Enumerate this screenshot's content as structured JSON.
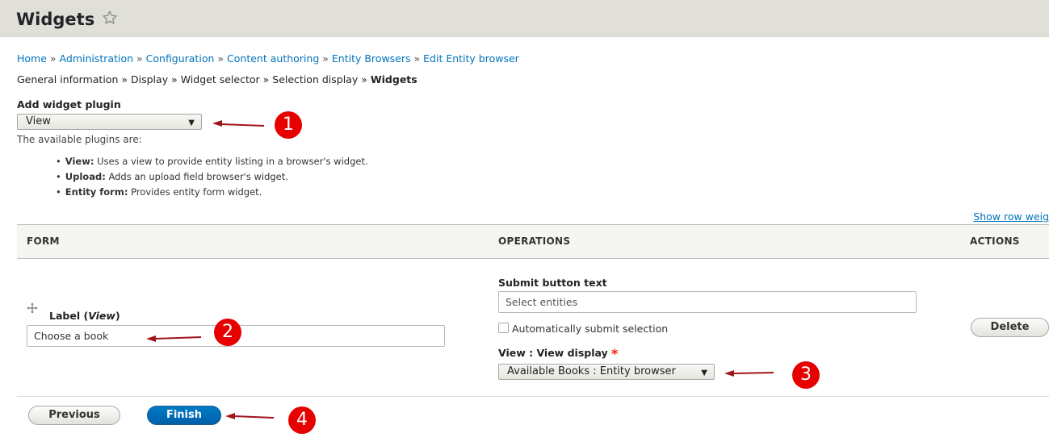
{
  "header": {
    "title": "Widgets",
    "star_icon": "star-outline-icon"
  },
  "breadcrumb": {
    "items": [
      "Home",
      "Administration",
      "Configuration",
      "Content authoring",
      "Entity Browsers",
      "Edit Entity browser"
    ],
    "separator": "»"
  },
  "wizard_steps": {
    "items": [
      "General information",
      "Display",
      "Widget selector",
      "Selection display"
    ],
    "current": "Widgets",
    "separator": "»"
  },
  "add_widget": {
    "label": "Add widget plugin",
    "selected": "View",
    "help_intro": "The available plugins are:",
    "plugins": [
      {
        "name": "View:",
        "desc": "Uses a view to provide entity listing in a browser's widget."
      },
      {
        "name": "Upload:",
        "desc": "Adds an upload field browser's widget."
      },
      {
        "name": "Entity form:",
        "desc": "Provides entity form widget."
      }
    ]
  },
  "table": {
    "show_row_weights": "Show row weig",
    "headers": {
      "form": "FORM",
      "operations": "OPERATIONS",
      "actions": "ACTIONS"
    },
    "row": {
      "label_prefix": "Label (",
      "label_em": "View",
      "label_suffix": ")",
      "label_value": "Choose a book",
      "submit_label": "Submit button text",
      "submit_value": "Select entities",
      "auto_submit_label": "Automatically submit selection",
      "auto_submit_checked": false,
      "view_display_label": "View : View display",
      "required_mark": "*",
      "view_display_selected": "Available Books : Entity browser",
      "delete_label": "Delete"
    }
  },
  "footer": {
    "previous_label": "Previous",
    "finish_label": "Finish"
  },
  "annotations": {
    "badges": [
      "1",
      "2",
      "3",
      "4"
    ],
    "color": "#e60000",
    "arrow_color": "#a0141a"
  },
  "colors": {
    "link": "#0074bd",
    "primary_button": "#0069b4",
    "header_bg": "#e0e0d8",
    "required": "#e62600"
  }
}
